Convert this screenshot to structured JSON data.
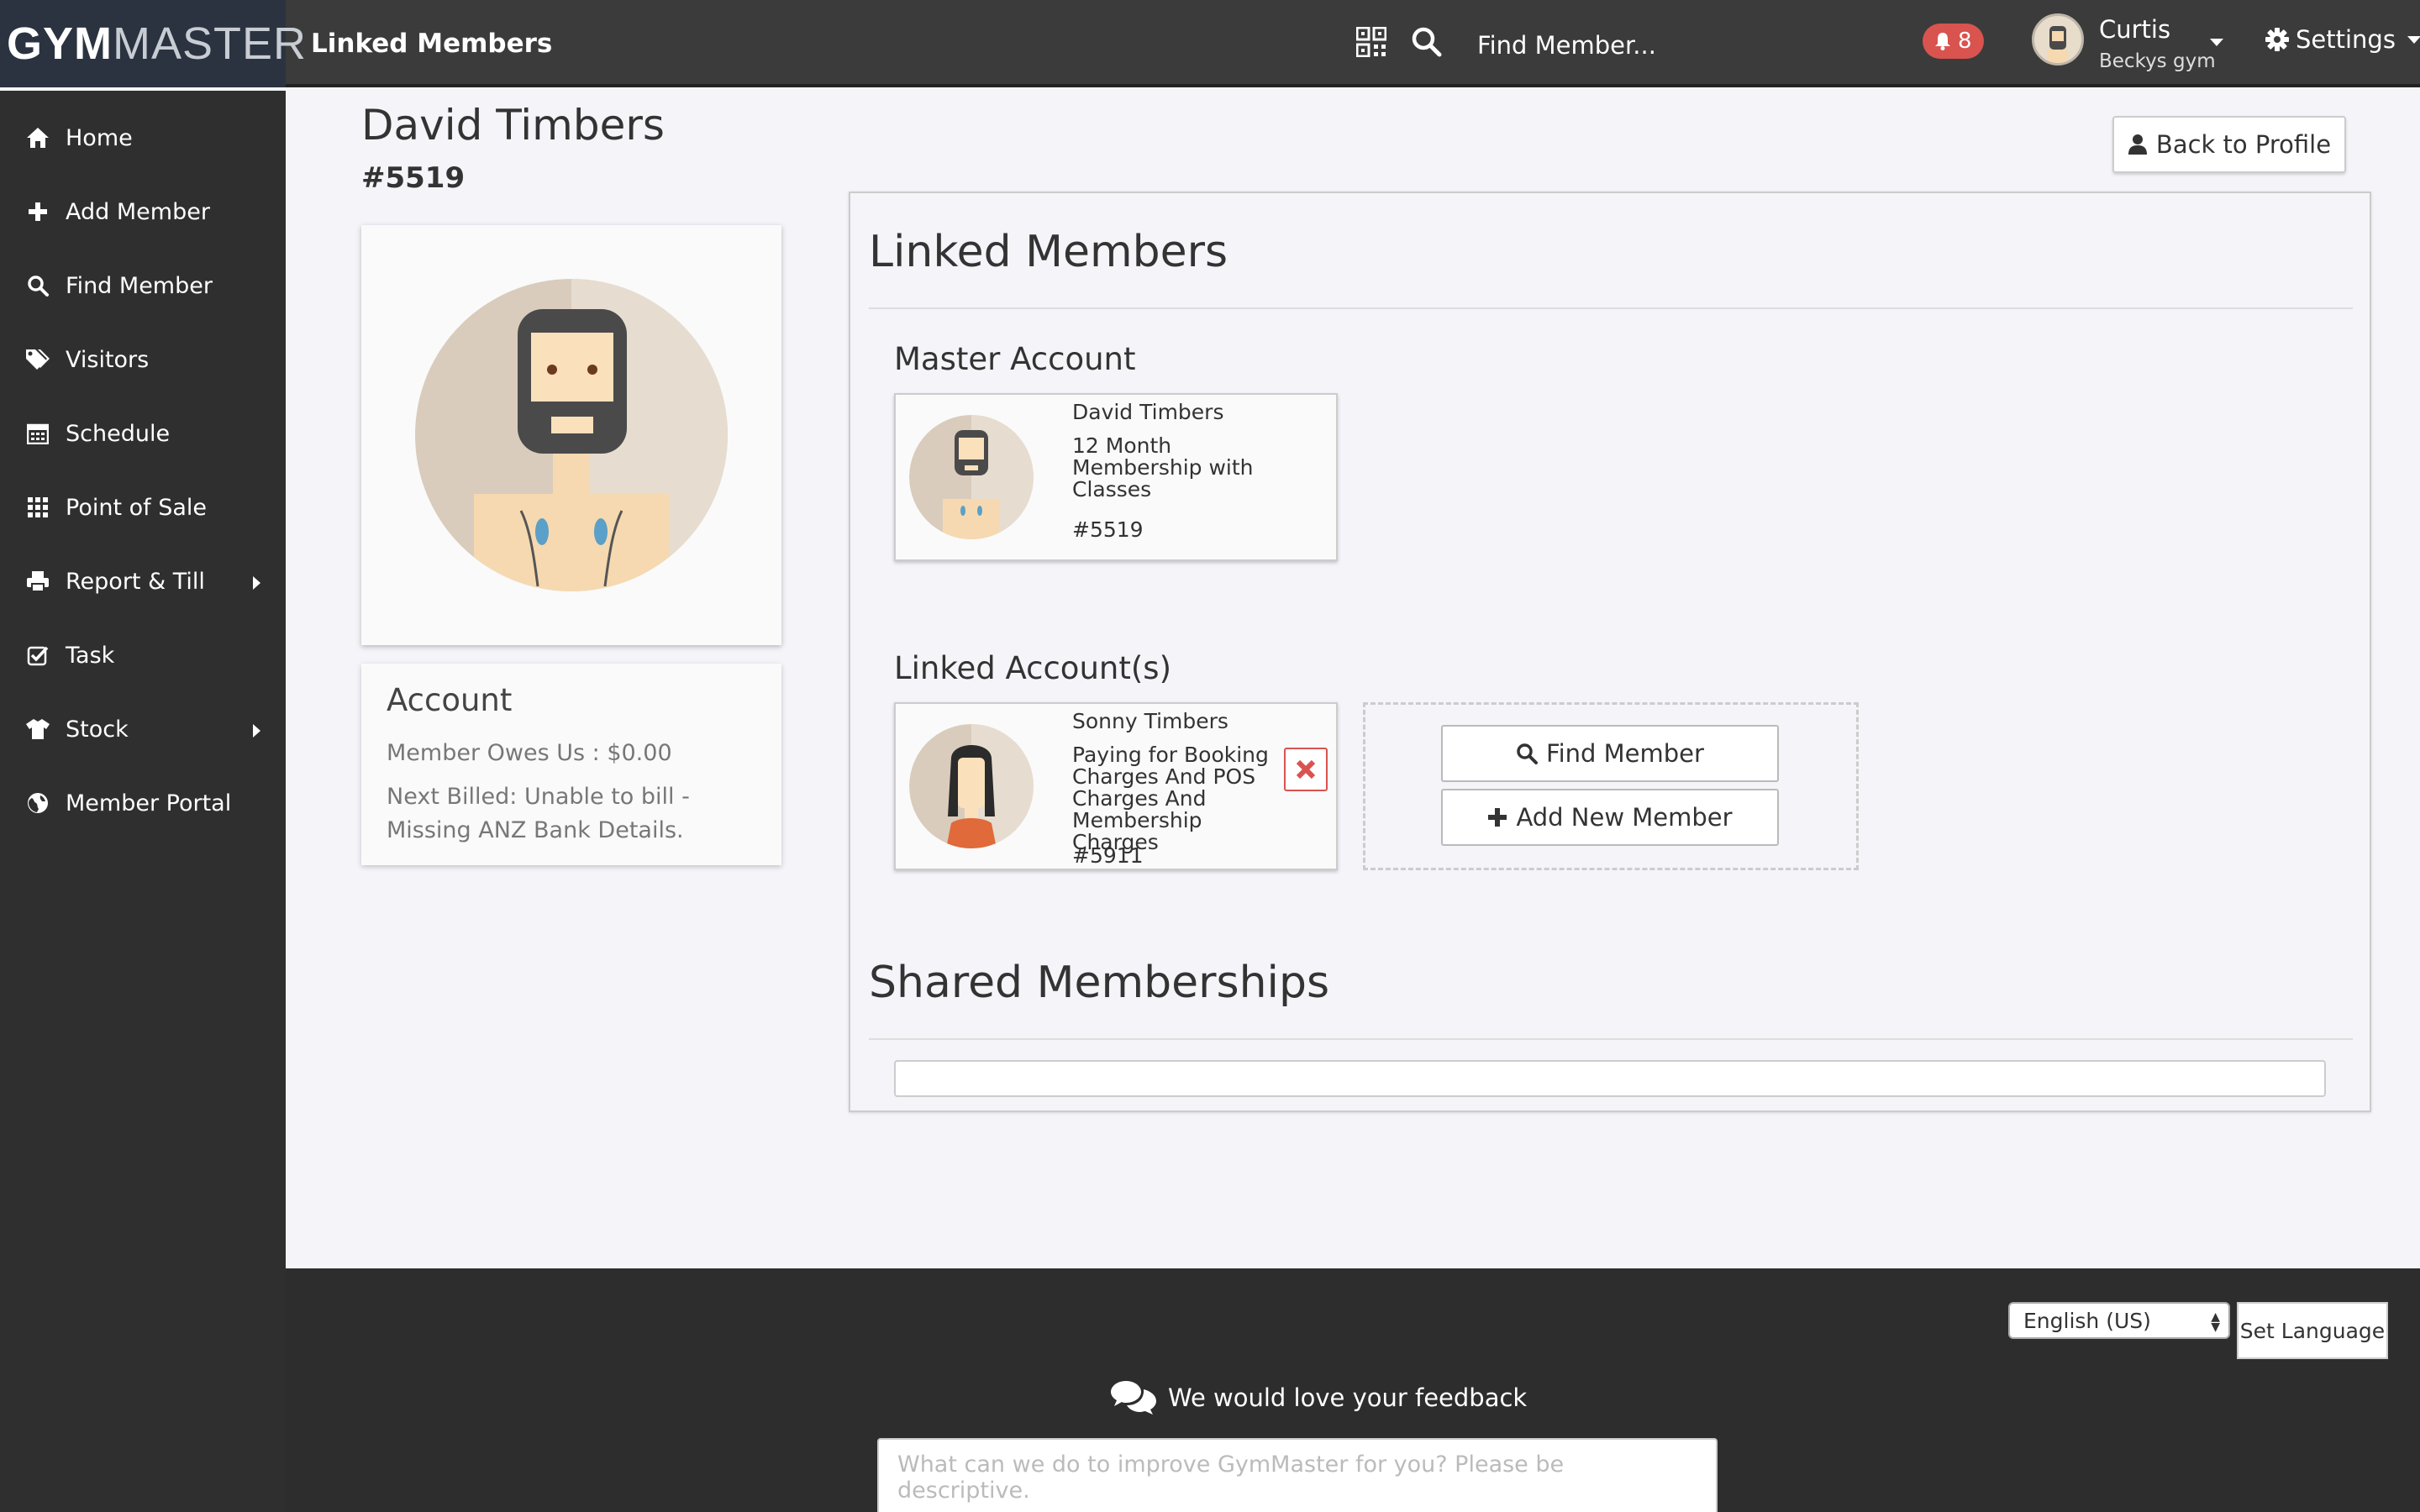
{
  "app": {
    "logo_gym": "GYM",
    "logo_master": "MASTER",
    "page_title": "Linked Members"
  },
  "topbar": {
    "search_placeholder": "Find Member...",
    "notification_count": "8",
    "user_name": "Curtis",
    "user_gym": "Beckys gym",
    "settings_label": "Settings"
  },
  "sidebar": {
    "items": [
      {
        "label": "Home",
        "icon": "home-icon"
      },
      {
        "label": "Add Member",
        "icon": "plus-icon"
      },
      {
        "label": "Find Member",
        "icon": "search-icon"
      },
      {
        "label": "Visitors",
        "icon": "tags-icon"
      },
      {
        "label": "Schedule",
        "icon": "calendar-icon"
      },
      {
        "label": "Point of Sale",
        "icon": "grid-icon"
      },
      {
        "label": "Report & Till",
        "icon": "print-icon"
      },
      {
        "label": "Task",
        "icon": "check-icon"
      },
      {
        "label": "Stock",
        "icon": "shirt-icon"
      },
      {
        "label": "Member Portal",
        "icon": "globe-icon"
      }
    ]
  },
  "member": {
    "name": "David Timbers",
    "id": "#5519"
  },
  "back_button_label": "Back to Profile",
  "account": {
    "title": "Account",
    "owes": "Member Owes Us : $0.00",
    "next_billed": "Next Billed: Unable to bill - Missing ANZ Bank Details."
  },
  "linked": {
    "title": "Linked Members",
    "master_title": "Master Account",
    "master": {
      "name": "David Timbers",
      "membership": "12 Month Membership with Classes",
      "id": "#5519"
    },
    "linked_title": "Linked Account(s)",
    "linked_account": {
      "name": "Sonny Timbers",
      "description": "Paying for Booking Charges And POS Charges And Membership Charges",
      "id": "#5911"
    },
    "find_member_label": "Find Member",
    "add_new_member_label": "Add New Member",
    "shared_title": "Shared Memberships"
  },
  "footer": {
    "language_selected": "English (US)",
    "set_language_label": "Set Language",
    "feedback_title": "We would love your feedback",
    "feedback_placeholder": "What can we do to improve GymMaster for you? Please be descriptive."
  },
  "colors": {
    "topbar": "#3b3b3b",
    "sidebar": "#2f2f2f",
    "logo_bg": "#2b3340",
    "badge": "#d9534f",
    "remove": "#d9534f",
    "footer": "#2d2d2d"
  }
}
